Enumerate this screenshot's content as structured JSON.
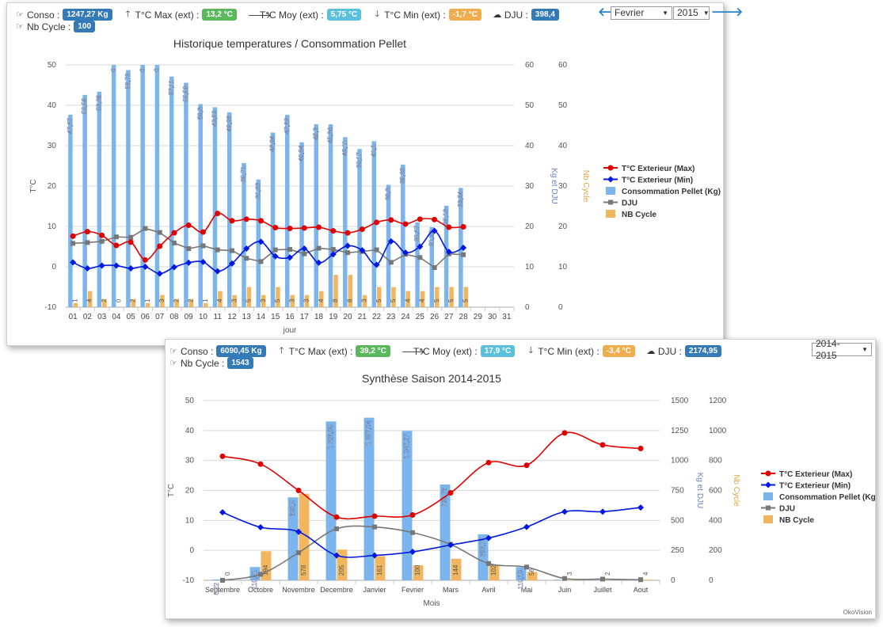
{
  "top": {
    "conso_label": "Conso :",
    "conso_value": "1247,27 Kg",
    "tmax_label": "T°C Max (ext) :",
    "tmax_value": "13,2 °C",
    "tmoy_label": "T°C Moy (ext) :",
    "tmoy_value": "5,75 °C",
    "tmin_label": "T°C Min (ext) :",
    "tmin_value": "-1,7 °C",
    "dju_label": "DJU :",
    "dju_value": "398,4",
    "cycle_label": "Nb Cycle :",
    "cycle_value": "100",
    "month_select": "Fevrier",
    "year_select": "2015"
  },
  "bottom": {
    "conso_label": "Conso :",
    "conso_value": "6090,45 Kg",
    "tmax_label": "T°C Max (ext) :",
    "tmax_value": "39,2 °C",
    "tmoy_label": "T°C Moy (ext) :",
    "tmoy_value": "17,9 °C",
    "tmin_label": "T°C Min (ext) :",
    "tmin_value": "-3,4 °C",
    "dju_label": "DJU :",
    "dju_value": "2174,95",
    "cycle_label": "Nb Cycle :",
    "cycle_value": "1543",
    "season_select": "2014-2015",
    "credit": "OkoVision"
  },
  "icons": {
    "hand": "hand-pointer-icon",
    "up": "arrow-up-icon",
    "right": "arrow-right-icon",
    "down": "arrow-down-icon",
    "cloud": "cloud-icon",
    "prev": "arrow-left-icon",
    "next": "arrow-right-icon"
  },
  "chart_data": [
    {
      "type": "bar",
      "title": "Historique temperatures / Consommation Pellet",
      "xlabel": "jour",
      "ylabel": "T°C",
      "ylabel_right": "Kg et DJU",
      "ylabel_right2": "Nb Cycle",
      "ylim": [
        -10,
        50
      ],
      "ylim_right": [
        0,
        60
      ],
      "ylim_right2": [
        0,
        60
      ],
      "yticks": [
        -10,
        0,
        10,
        20,
        30,
        40,
        50
      ],
      "yticks_right": [
        0,
        10,
        20,
        30,
        40,
        50,
        60
      ],
      "grid": true,
      "legend_position": "right",
      "categories": [
        "01",
        "02",
        "03",
        "04",
        "05",
        "06",
        "07",
        "08",
        "09",
        "10",
        "11",
        "12",
        "13",
        "14",
        "15",
        "16",
        "17",
        "18",
        "19",
        "20",
        "21",
        "22",
        "23",
        "24",
        "25",
        "26",
        "27",
        "28",
        "29",
        "30",
        "31"
      ],
      "colors": {
        "tmax": "#e00000",
        "tmin": "#0018e0",
        "conso": "#7cb5ec",
        "dju": "#777777",
        "cycle": "#f0b660"
      },
      "series": [
        {
          "name": "T°C Exterieur (Max)",
          "type": "spline",
          "axis": "left",
          "values": [
            7.6,
            8.7,
            7.8,
            5.3,
            6.1,
            1.7,
            5.1,
            8.4,
            10.3,
            8.6,
            13.2,
            11.4,
            11.8,
            11.4,
            9.7,
            9.5,
            9.6,
            9.8,
            8.9,
            8.4,
            9.3,
            11.0,
            11.6,
            10.6,
            11.8,
            11.7,
            9.8,
            9.9,
            null,
            null,
            null
          ]
        },
        {
          "name": "T°C Exterieur (Min)",
          "type": "spline",
          "axis": "left",
          "values": [
            1.1,
            -0.4,
            0.3,
            0.3,
            -0.4,
            0.0,
            -1.7,
            -0.1,
            1.0,
            1.2,
            -1.1,
            0.8,
            4.5,
            6.2,
            2.6,
            2.3,
            4.5,
            1.0,
            3.1,
            5.2,
            4.1,
            0.5,
            6.3,
            3.5,
            5.0,
            8.9,
            3.7,
            4.7,
            null,
            null,
            null
          ]
        },
        {
          "name": "Consommation Pellet (Kg)",
          "type": "bar",
          "axis": "right",
          "values": [
            47.67,
            52.58,
            53.38,
            60,
            58.73,
            60,
            60,
            57.11,
            55.58,
            50.3,
            49.52,
            48.26,
            35.71,
            31.63,
            43.24,
            47.63,
            40.84,
            45.3,
            45.3,
            42.11,
            39.17,
            41.1,
            30.3,
            35.32,
            21.0,
            19.81,
            25.13,
            29.54,
            null,
            null,
            null
          ],
          "labels": [
            "47,67",
            "52,58",
            "53,38",
            "0",
            "58,73",
            "0",
            "0",
            "57,11",
            "55,58",
            "50,3",
            "49,52",
            "48,26",
            "35,71",
            "31,63",
            "43,24",
            "47,63",
            "40,84",
            "45,3",
            "45,34",
            "42,11",
            "39,17",
            "41,1",
            "30,3",
            "35,32",
            "20,67",
            "21,22",
            "25,13",
            "29,54",
            null,
            null,
            null
          ]
        },
        {
          "name": "DJU",
          "type": "line",
          "axis": "right",
          "values": [
            15.8,
            16.0,
            16.3,
            17.4,
            17.3,
            19.5,
            18.5,
            15.9,
            14.5,
            15.2,
            14.2,
            14.0,
            12.1,
            11.3,
            14.2,
            14.3,
            13.2,
            14.6,
            14.3,
            13.5,
            13.8,
            14.2,
            11.1,
            13.1,
            12.3,
            9.8,
            13.2,
            13.0,
            null,
            null,
            null
          ]
        },
        {
          "name": "NB Cycle",
          "type": "bar",
          "axis": "right2",
          "values": [
            1,
            4,
            2,
            0,
            2,
            1,
            3,
            2,
            2,
            1,
            4,
            3,
            5,
            3,
            5,
            3,
            3,
            4,
            8,
            8,
            3,
            5,
            5,
            4,
            4,
            5,
            5,
            5,
            null,
            null,
            null
          ]
        }
      ]
    },
    {
      "type": "bar",
      "title": "Synthèse Saison 2014-2015",
      "xlabel": "Mois",
      "ylabel": "T°C",
      "ylabel_right": "Kg et DJU",
      "ylabel_right2": "Nb Cycle",
      "ylim": [
        -10,
        50
      ],
      "ylim_right": [
        0,
        1500
      ],
      "ylim_right2": [
        0,
        1200
      ],
      "yticks": [
        -10,
        0,
        10,
        20,
        30,
        40,
        50
      ],
      "yticks_right": [
        0,
        250,
        500,
        750,
        1000,
        1250,
        1500
      ],
      "yticks_right2": [
        0,
        200,
        400,
        600,
        800,
        1000,
        1200
      ],
      "grid": true,
      "legend_position": "right",
      "categories": [
        "Septembre",
        "Octobre",
        "Novembre",
        "Decembre",
        "Janvier",
        "Fevrier",
        "Mars",
        "Avril",
        "Mai",
        "Juin",
        "Juillet",
        "Aout"
      ],
      "colors": {
        "tmax": "#e00000",
        "tmin": "#0018e0",
        "conso": "#7cb5ec",
        "dju": "#777777",
        "cycle": "#f0b660"
      },
      "series": [
        {
          "name": "T°C Exterieur (Max)",
          "type": "spline",
          "axis": "left",
          "values": [
            31.4,
            28.8,
            20.0,
            11.1,
            11.4,
            11.8,
            19.2,
            29.3,
            28.4,
            39.2,
            35.2,
            34.0
          ]
        },
        {
          "name": "T°C Exterieur (Min)",
          "type": "spline",
          "axis": "left",
          "values": [
            12.7,
            7.7,
            6.2,
            -1.7,
            -1.7,
            -0.5,
            1.8,
            4.1,
            7.8,
            12.9,
            12.9,
            14.3
          ]
        },
        {
          "name": "Consommation Pellet (Kg)",
          "type": "bar",
          "axis": "right",
          "values": [
            6.22,
            110.51,
            692.5,
            1326.05,
            1357.04,
            1247.27,
            799.76,
            383.75,
            110.19,
            5,
            2,
            1
          ],
          "labels": [
            "6,22",
            "110,51",
            "692,5",
            "1 326,05",
            "1 357,04",
            "1 247,27",
            "799,76",
            "383,75",
            "110,19",
            "",
            "",
            ""
          ]
        },
        {
          "name": "DJU",
          "type": "line",
          "axis": "right",
          "values": [
            0,
            50,
            230,
            430,
            445,
            398,
            300,
            140,
            110,
            15,
            10,
            5
          ]
        },
        {
          "name": "NB Cycle",
          "type": "bar",
          "axis": "right2",
          "values": [
            0,
            194,
            578,
            205,
            161,
            100,
            144,
            102,
            56,
            3,
            2,
            4
          ]
        }
      ]
    }
  ]
}
